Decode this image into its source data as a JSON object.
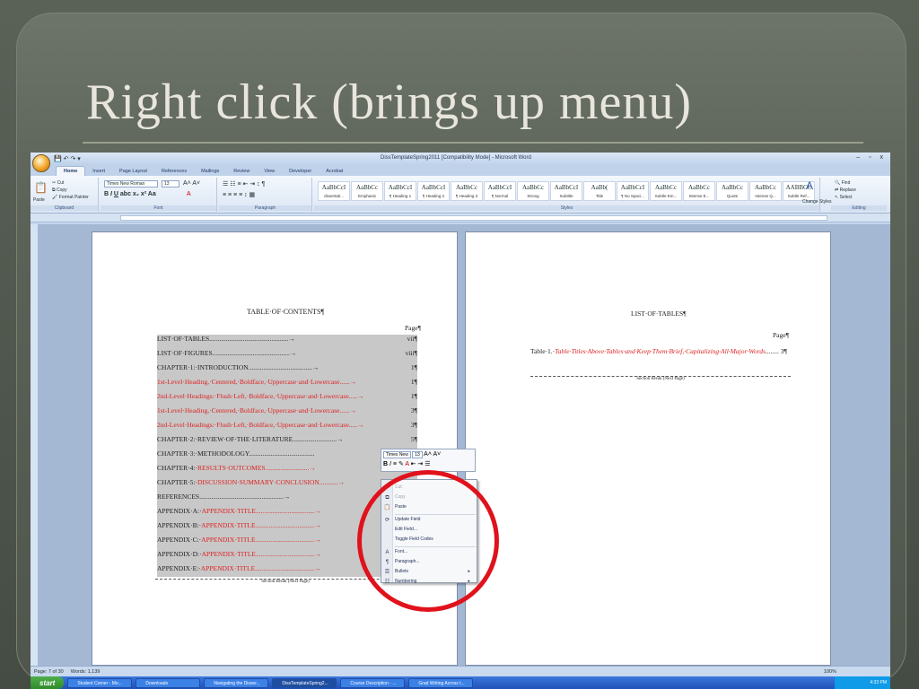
{
  "slide": {
    "title": "Right click (brings up menu)"
  },
  "window": {
    "title": "DissTemplateSpring2011 [Compatibility Mode] - Microsoft Word",
    "controls": "– ▫ x"
  },
  "ribbon": {
    "tabs": [
      "Home",
      "Insert",
      "Page Layout",
      "References",
      "Mailings",
      "Review",
      "View",
      "Developer",
      "Acrobat"
    ],
    "clipboard": {
      "label": "Clipboard",
      "paste": "Paste",
      "cut": "Cut",
      "copy": "Copy",
      "format_painter": "Format Painter"
    },
    "font": {
      "label": "Font",
      "name": "Times New Roman",
      "size": "13"
    },
    "paragraph": {
      "label": "Paragraph"
    },
    "styles": {
      "label": "Styles",
      "items": [
        {
          "preview": "AaBbCcI",
          "name": "dissertati..."
        },
        {
          "preview": "AaBbCc",
          "name": "Emphasis"
        },
        {
          "preview": "AaBbCcI",
          "name": "¶ Heading 1"
        },
        {
          "preview": "AaBbCcI",
          "name": "¶ Heading 2"
        },
        {
          "preview": "AaBbCc",
          "name": "¶ Heading 3"
        },
        {
          "preview": "AaBbCcI",
          "name": "¶ Normal"
        },
        {
          "preview": "AaBbCc",
          "name": "Strong"
        },
        {
          "preview": "AaBbCcI",
          "name": "Subtitle"
        },
        {
          "preview": "AaBb(",
          "name": "Title"
        },
        {
          "preview": "AaBbCcI",
          "name": "¶ No Spaci..."
        },
        {
          "preview": "AaBbCc",
          "name": "Subtle Em..."
        },
        {
          "preview": "AaBbCc",
          "name": "Intense E..."
        },
        {
          "preview": "AaBbCc",
          "name": "Quote"
        },
        {
          "preview": "AaBbCc",
          "name": "Intense Q..."
        },
        {
          "preview": "AABBCC",
          "name": "Subtle Ref..."
        }
      ],
      "change_styles": "Change Styles"
    },
    "editing": {
      "label": "Editing",
      "find": "Find",
      "replace": "Replace",
      "select": "Select"
    }
  },
  "page1": {
    "toc_title": "TABLE·OF·CONTENTS¶",
    "page_label": "Page¶",
    "rows": [
      {
        "text": "LIST·OF·TABLES...............................................→",
        "page": "vii¶",
        "red": ""
      },
      {
        "text": "LIST·OF·FIGURES..............................................→",
        "page": "viii¶",
        "red": ""
      },
      {
        "text": "CHAPTER·1:·INTRODUCTION......................................→",
        "page": "1¶",
        "red": ""
      },
      {
        "text": "    ",
        "page": "1¶",
        "red": "1st-Level·Heading,·Centered,·Boldface,·Uppercase·and·Lowercase......→"
      },
      {
        "text": "        ",
        "page": "1¶",
        "red": "2nd-Level·Headings:·Flush·Left,·Boldface,·Uppercase·and·Lowercase.....→"
      },
      {
        "text": "    ",
        "page": "3¶",
        "red": "1st-Level·Heading,·Centered,·Boldface,·Uppercase·and·Lowercase......→"
      },
      {
        "text": "        ",
        "page": "3¶",
        "red": "2nd-Level·Headings:·Flush·Left,·Boldface,·Uppercase·and·Lowercase.....→"
      },
      {
        "text": "CHAPTER·2:·REVIEW·OF·THE·LITERATURE..........................→",
        "page": "5¶",
        "red": ""
      },
      {
        "text": "CHAPTER·3:·METHODOLOGY.......................................",
        "page": "",
        "red": ""
      },
      {
        "text": "CHAPTER·4:·",
        "page": "",
        "red": "RESULTS·OUTCOMES..........................→"
      },
      {
        "text": "CHAPTER·5:·",
        "page": "",
        "red": "DISCUSSION·SUMMARY·CONCLUSION...........→"
      },
      {
        "text": "REFERENCES..................................................→",
        "page": "",
        "red": ""
      },
      {
        "text": "APPENDIX·A:·",
        "page": "",
        "red": "APPENDIX·TITLE...................................→"
      },
      {
        "text": "APPENDIX·B:·",
        "page": "",
        "red": "APPENDIX·TITLE...................................→"
      },
      {
        "text": "APPENDIX·C:·",
        "page": "",
        "red": "APPENDIX·TITLE...................................→"
      },
      {
        "text": "APPENDIX·D:·",
        "page": "",
        "red": "APPENDIX·TITLE...................................→"
      },
      {
        "text": "APPENDIX·E:·",
        "page": "",
        "red": "APPENDIX·TITLE...................................→"
      }
    ],
    "section_break": "Section Break (Next Page)"
  },
  "page2": {
    "title": "LIST·OF·TABLES¶",
    "page_label": "Page¶",
    "row_prefix": "Table·1.·",
    "row_red": "Table·Titles·Above·Tables·and·Keep·Them·Brief,·Capitalizing·All·Major·Words",
    "row_page": "3¶",
    "section_break": "Section Break (Next Page)"
  },
  "mini_toolbar": {
    "font": "Times New",
    "size": "13"
  },
  "context_menu": {
    "items": [
      {
        "label": "Cut",
        "icon": "✂",
        "disabled": true
      },
      {
        "label": "Copy",
        "icon": "⧉",
        "disabled": true
      },
      {
        "label": "Paste",
        "icon": "📋",
        "disabled": false
      },
      {
        "label": "Update Field",
        "icon": "⟳",
        "disabled": false
      },
      {
        "label": "Edit Field...",
        "icon": "",
        "disabled": false
      },
      {
        "label": "Toggle Field Codes",
        "icon": "",
        "disabled": false
      },
      {
        "label": "Font...",
        "icon": "A",
        "disabled": false
      },
      {
        "label": "Paragraph...",
        "icon": "¶",
        "disabled": false
      },
      {
        "label": "Bullets",
        "icon": "☰",
        "disabled": false,
        "submenu": true
      },
      {
        "label": "Numbering",
        "icon": "☷",
        "disabled": false,
        "submenu": true
      }
    ]
  },
  "status": {
    "page": "Page: 7 of 30",
    "words": "Words: 1,139",
    "zoom": "100%"
  },
  "taskbar": {
    "start": "start",
    "tasks": [
      "Student Corner - Mo...",
      "Downloads",
      "Navigating the Disser...",
      "DissTemplateSpring2...",
      "Course Description - ...",
      "Grad Writing Across t..."
    ],
    "clock": "4:33 PM"
  },
  "colors": {
    "highlight_circle": "#e0121c",
    "field_text_red": "#d22222",
    "ribbon_blue": "#c5d6ec"
  }
}
